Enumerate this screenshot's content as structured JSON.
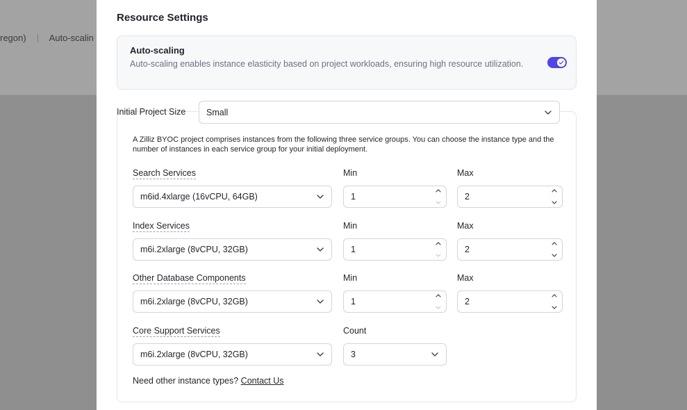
{
  "background": {
    "breadcrumb": {
      "region_tail": "regon)",
      "autoscaling": "Auto-scalin"
    }
  },
  "modal": {
    "title": "Resource Settings",
    "autoscaling": {
      "title": "Auto-scaling",
      "description": "Auto-scaling enables instance elasticity based on project workloads, ensuring high resource utilization.",
      "enabled": true
    },
    "initial_size": {
      "label": "Initial Project Size",
      "value": "Small"
    },
    "groups_description": "A Zilliz BYOC project comprises instances from the following three service groups. You can choose the instance type and the number of instances in each service group for your initial deployment.",
    "groups": [
      {
        "name": "Search Services",
        "instance": "m6id.4xlarge (16vCPU, 64GB)",
        "min_label": "Min",
        "min": "1",
        "max_label": "Max",
        "max": "2"
      },
      {
        "name": "Index Services",
        "instance": "m6i.2xlarge (8vCPU, 32GB)",
        "min_label": "Min",
        "min": "1",
        "max_label": "Max",
        "max": "2"
      },
      {
        "name": "Other Database Components",
        "instance": "m6i.2xlarge (8vCPU, 32GB)",
        "min_label": "Min",
        "min": "1",
        "max_label": "Max",
        "max": "2"
      }
    ],
    "core": {
      "name": "Core Support Services",
      "instance": "m6i.2xlarge (8vCPU, 32GB)",
      "count_label": "Count",
      "count": "3"
    },
    "footer": {
      "question": "Need other instance types?",
      "link": "Contact Us"
    }
  },
  "colors": {
    "accent": "#4f46e5",
    "border": "#d1d5db",
    "muted_text": "#6b7280"
  }
}
